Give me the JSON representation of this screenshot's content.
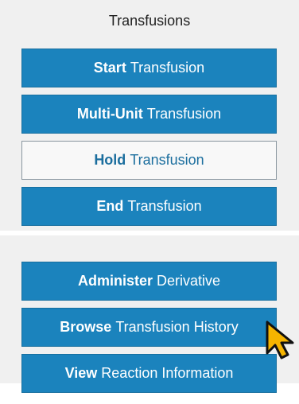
{
  "panel": {
    "title": "Transfusions"
  },
  "buttons": {
    "start": {
      "bold": "Start",
      "rest": "Transfusion"
    },
    "multi_unit": {
      "bold": "Multi-Unit",
      "rest": "Transfusion"
    },
    "hold": {
      "bold": "Hold",
      "rest": "Transfusion"
    },
    "end": {
      "bold": "End",
      "rest": "Transfusion"
    },
    "administer": {
      "bold": "Administer",
      "rest": "Derivative"
    },
    "browse": {
      "bold": "Browse",
      "rest": "Transfusion History"
    },
    "view": {
      "bold": "View",
      "rest": "Reaction Information"
    }
  },
  "colors": {
    "primary": "#1b83bd",
    "panel_bg": "#f0f0f0",
    "cursor": "#f5b400"
  },
  "icons": {
    "cursor": "pointer-arrow-icon"
  }
}
